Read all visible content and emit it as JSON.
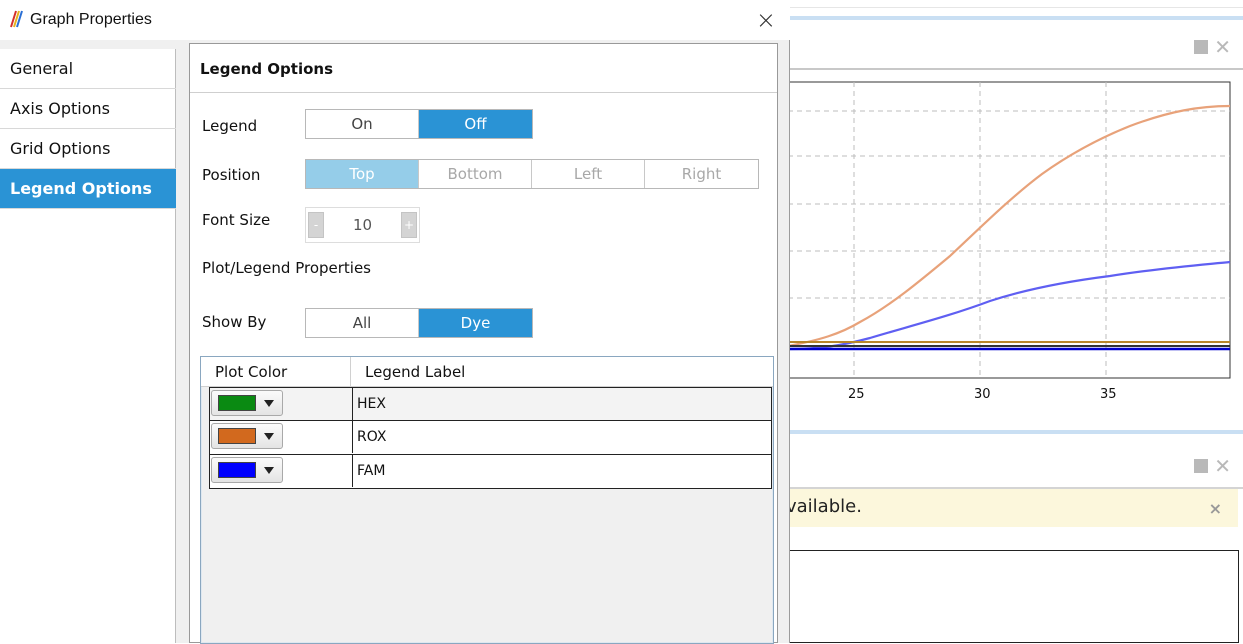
{
  "dialog": {
    "title": "Graph Properties",
    "close_glyph": "×",
    "nav": [
      {
        "label": "General",
        "active": false
      },
      {
        "label": "Axis Options",
        "active": false
      },
      {
        "label": "Grid Options",
        "active": false
      },
      {
        "label": "Legend Options",
        "active": true
      }
    ],
    "section_title": "Legend Options",
    "legend": {
      "label": "Legend",
      "options": [
        "On",
        "Off"
      ],
      "selected": "Off"
    },
    "position": {
      "label": "Position",
      "options": [
        "Top",
        "Bottom",
        "Left",
        "Right"
      ],
      "selected": "Top",
      "disabled": true
    },
    "font_size": {
      "label": "Font Size",
      "value": "10",
      "minus": "-",
      "plus": "+"
    },
    "plot_props_label": "Plot/Legend Properties",
    "show_by": {
      "label": "Show By",
      "options": [
        "All",
        "Dye"
      ],
      "selected": "Dye"
    },
    "grid": {
      "headers": [
        "Plot Color",
        "Legend Label"
      ],
      "rows": [
        {
          "color": "#0a8a12",
          "label": "HEX"
        },
        {
          "color": "#d2691e",
          "label": "ROX"
        },
        {
          "color": "#0000ff",
          "label": "FAM"
        }
      ]
    }
  },
  "background": {
    "chart_ticks": [
      "25",
      "30",
      "35"
    ],
    "notice_text": "vailable.",
    "notice_close": "×",
    "panel_close": "✕",
    "colors": {
      "orange_curve": "#e8a27a",
      "blue_curve": "#5f5ff2",
      "accent": "#2a93d5"
    }
  }
}
